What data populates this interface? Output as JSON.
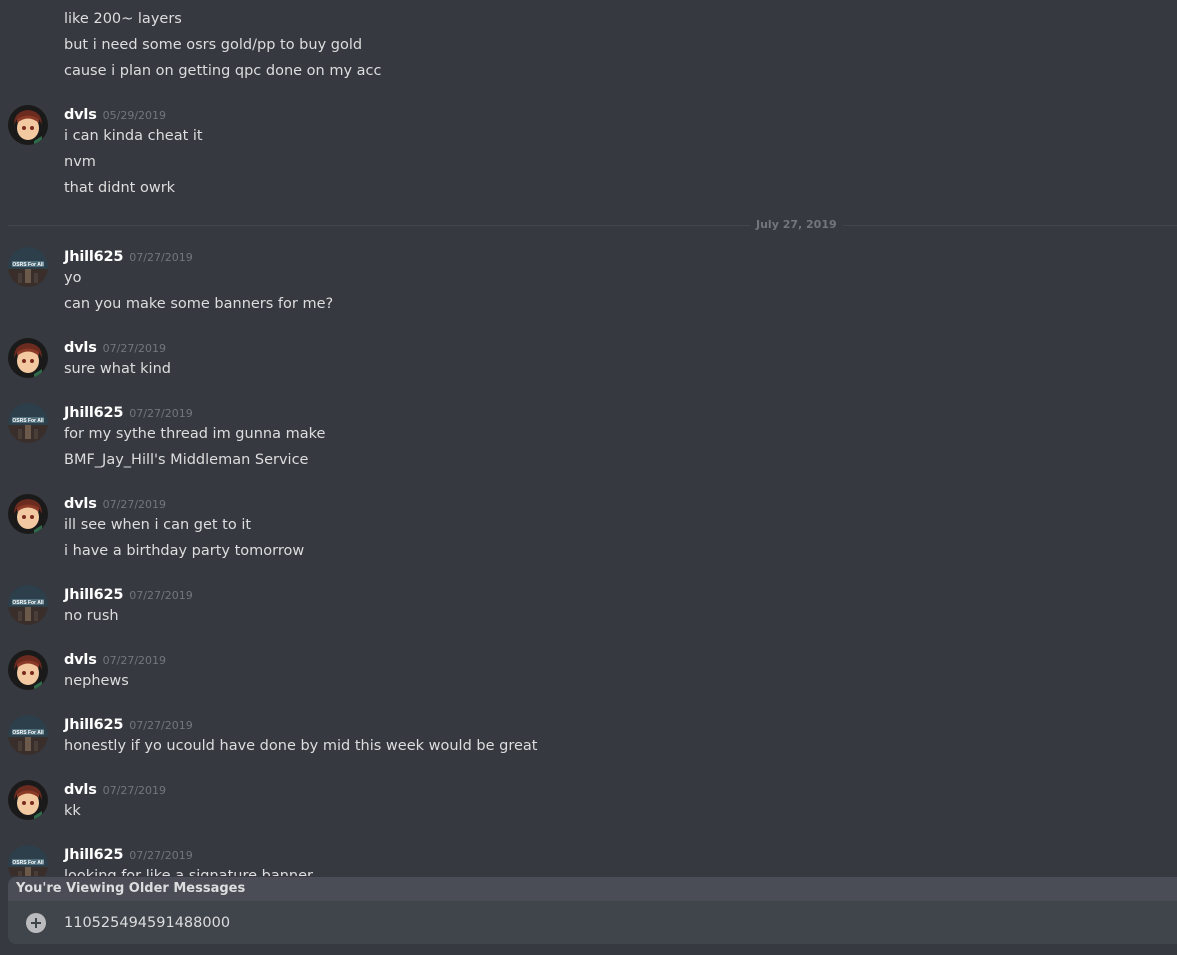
{
  "messages_top": {
    "lines": [
      "like 200~ layers",
      "but i need some osrs gold/pp to buy gold",
      "cause i plan on getting qpc done on my acc"
    ]
  },
  "date_divider": "July 27, 2019",
  "groups": [
    {
      "author": "dvls",
      "timestamp": "05/29/2019",
      "avatar": "dvls-avatar",
      "lines": [
        "i can kinda cheat it",
        "nvm",
        "that didnt owrk"
      ]
    },
    {
      "author": "Jhill625",
      "timestamp": "07/27/2019",
      "avatar": "jhill-avatar",
      "lines": [
        "yo",
        "can you make some banners for me?"
      ]
    },
    {
      "author": "dvls",
      "timestamp": "07/27/2019",
      "avatar": "dvls-avatar",
      "lines": [
        "sure what kind"
      ]
    },
    {
      "author": "Jhill625",
      "timestamp": "07/27/2019",
      "avatar": "jhill-avatar",
      "lines": [
        "for my sythe thread im gunna make",
        "BMF_Jay_Hill's Middleman Service"
      ]
    },
    {
      "author": "dvls",
      "timestamp": "07/27/2019",
      "avatar": "dvls-avatar",
      "lines": [
        "ill see when i can get to it",
        "i have a birthday party tomorrow"
      ]
    },
    {
      "author": "Jhill625",
      "timestamp": "07/27/2019",
      "avatar": "jhill-avatar",
      "lines": [
        "no rush"
      ]
    },
    {
      "author": "dvls",
      "timestamp": "07/27/2019",
      "avatar": "dvls-avatar",
      "lines": [
        "nephews"
      ]
    },
    {
      "author": "Jhill625",
      "timestamp": "07/27/2019",
      "avatar": "jhill-avatar",
      "lines": [
        "honestly if yo ucould have done by mid this week would be great"
      ]
    },
    {
      "author": "dvls",
      "timestamp": "07/27/2019",
      "avatar": "dvls-avatar",
      "lines": [
        "kk"
      ]
    },
    {
      "author": "Jhill625",
      "timestamp": "07/27/2019",
      "avatar": "jhill-avatar",
      "lines": [
        "looking for like a signature banner"
      ]
    }
  ],
  "older_messages_label": "You're Viewing Older Messages",
  "composer": {
    "value": "110525494591488000",
    "attach_icon": "plus-circle-icon"
  },
  "colors": {
    "background": "#36393f",
    "input_bg": "#40444b",
    "older_bar_bg": "#4a4d55",
    "author": "#ffffff",
    "text": "#dcddde",
    "timestamp": "#72767d"
  }
}
